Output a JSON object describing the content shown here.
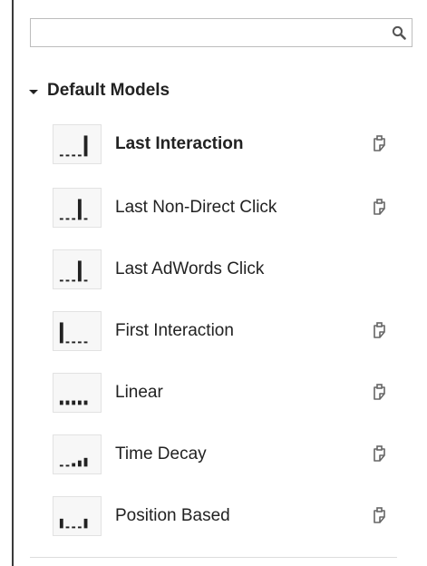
{
  "search": {
    "value": "",
    "placeholder": ""
  },
  "section": {
    "title": "Default Models",
    "expanded": true
  },
  "models": [
    {
      "label": "Last Interaction",
      "icon": "last-interaction-chart-icon",
      "selected": true,
      "copy_action": true
    },
    {
      "label": "Last Non-Direct Click",
      "icon": "last-non-direct-click-chart-icon",
      "selected": false,
      "copy_action": true
    },
    {
      "label": "Last AdWords Click",
      "icon": "last-adwords-click-chart-icon",
      "selected": false,
      "copy_action": false
    },
    {
      "label": "First Interaction",
      "icon": "first-interaction-chart-icon",
      "selected": false,
      "copy_action": true
    },
    {
      "label": "Linear",
      "icon": "linear-chart-icon",
      "selected": false,
      "copy_action": true
    },
    {
      "label": "Time Decay",
      "icon": "time-decay-chart-icon",
      "selected": false,
      "copy_action": true
    },
    {
      "label": "Position Based",
      "icon": "position-based-chart-icon",
      "selected": false,
      "copy_action": true
    }
  ],
  "colors": {
    "text": "#222222",
    "thumb_bar": "#222222",
    "thumb_background": "#f7f7f7",
    "thumb_border": "#e2e2e2",
    "icon": "#666666"
  }
}
